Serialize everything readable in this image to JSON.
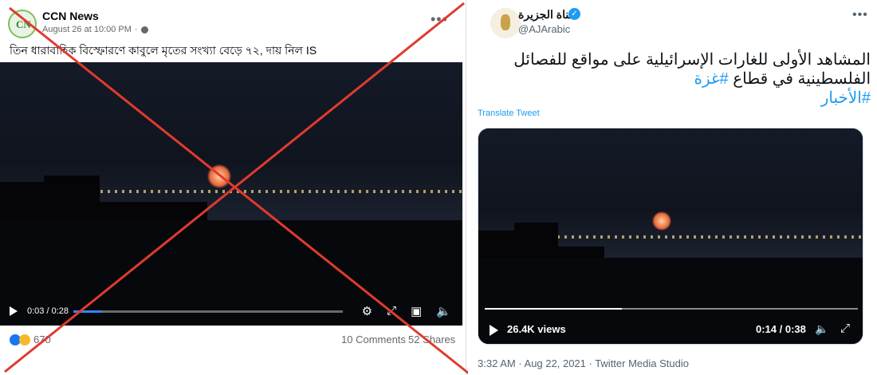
{
  "facebook": {
    "page_name": "CCN News",
    "avatar_text": "CN",
    "timestamp": "August 26 at 10:00 PM",
    "more_icon": "more-dots-icon",
    "post_text": "তিন ধারাবাহিক বিস্ফোরণে কাবুলে মৃতের সংখ্যা বেড়ে ৭২, দায় নিল IS",
    "video": {
      "time": "0:03 / 0:28",
      "progress": 0.107
    },
    "reaction_count": "670",
    "comments": "10 Comments",
    "shares": "52 Shares"
  },
  "twitter": {
    "account_name": "قناة الجزيرة",
    "handle": "@AJArabic",
    "more_icon": "more-dots-icon",
    "tweet_line1": "المشاهد الأولى للغارات الإسرائيلية على مواقع للفصائل",
    "tweet_line2_text": "الفلسطينية في قطاع ",
    "tweet_line2_tag": "#غزة",
    "tweet_line3_tag": "#الأخبار",
    "translate_label": "Translate Tweet",
    "video": {
      "views": "26.4K views",
      "time": "0:14 / 0:38",
      "progress": 0.368
    },
    "footer": "3:32 AM · Aug 22, 2021 · Twitter Media Studio"
  },
  "colors": {
    "cross_mark": "#e03a2f",
    "twitter_blue": "#1d9bf0",
    "facebook_blue": "#1877f2"
  }
}
